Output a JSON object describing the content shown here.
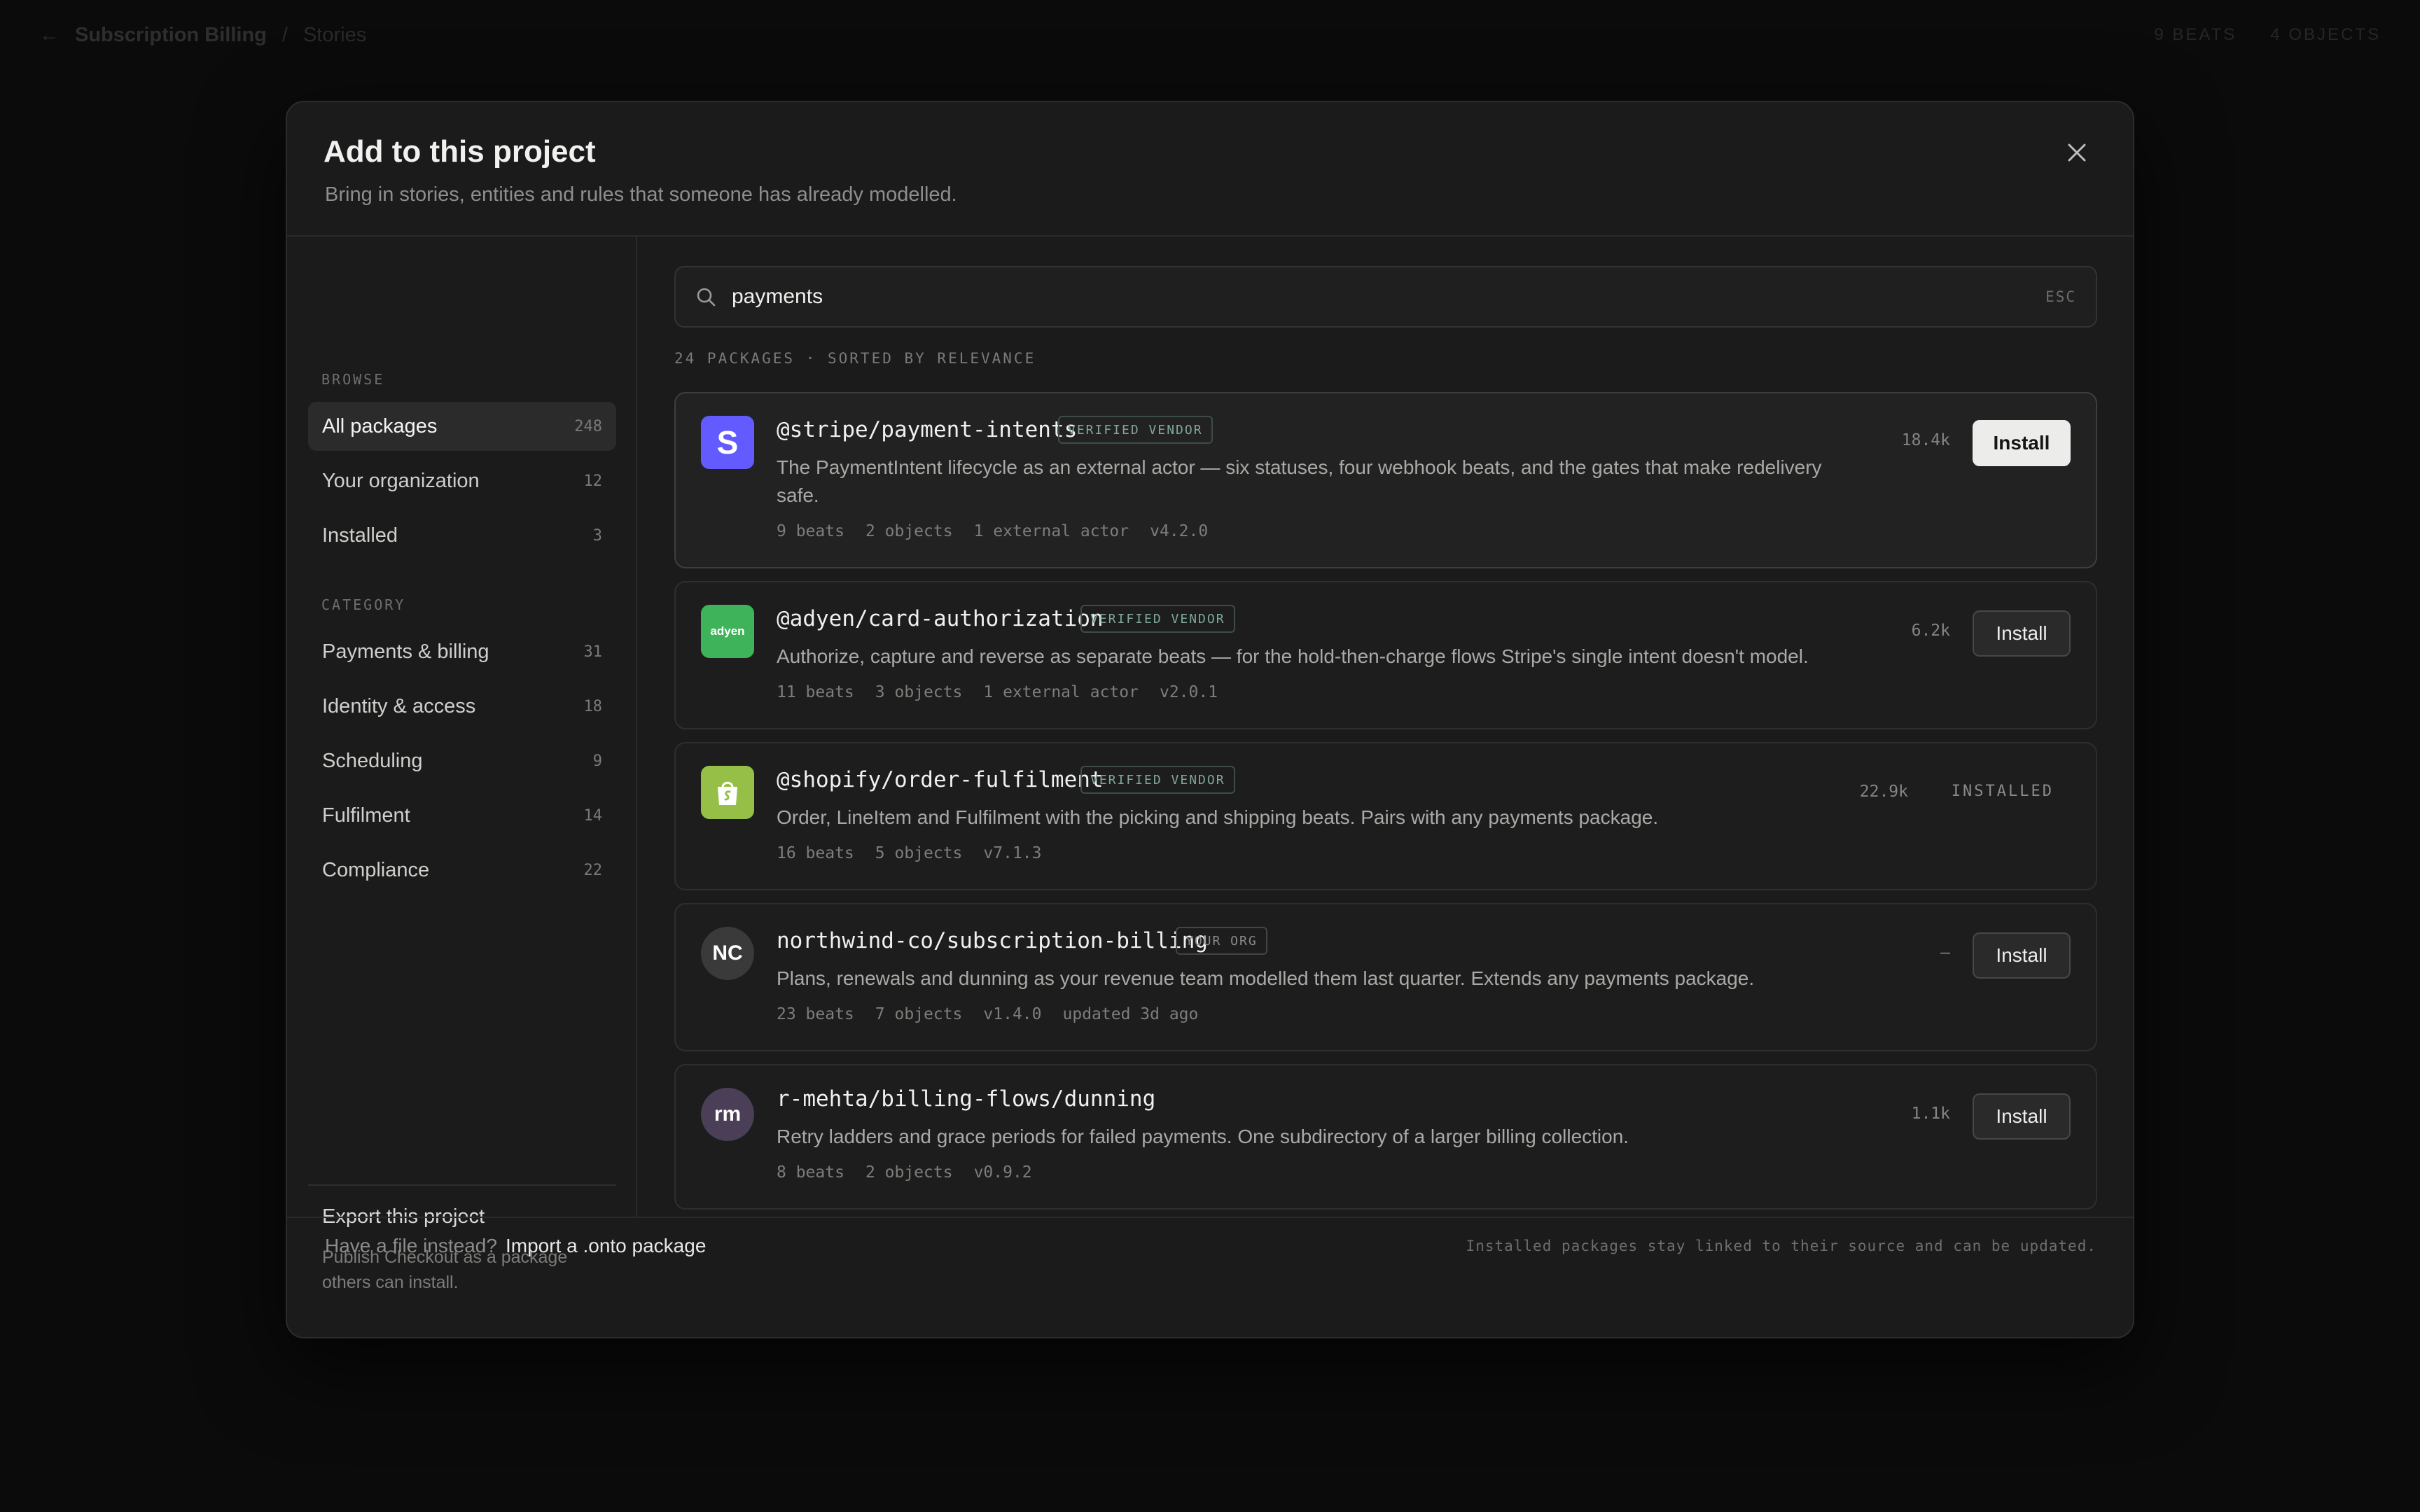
{
  "topbar": {
    "project": "Subscription Billing",
    "separator": "/",
    "section": "Stories",
    "right_a": "9 BEATS",
    "right_b": "4 OBJECTS"
  },
  "modal": {
    "title": "Add to this project",
    "subtitle": "Bring in stories, entities and rules that someone has already modelled."
  },
  "sidebar": {
    "browse_heading": "BROWSE",
    "browse": [
      {
        "label": "All packages",
        "count": "248"
      },
      {
        "label": "Your organization",
        "count": "12"
      },
      {
        "label": "Installed",
        "count": "3"
      }
    ],
    "category_heading": "CATEGORY",
    "categories": [
      {
        "label": "Payments & billing",
        "count": "31"
      },
      {
        "label": "Identity & access",
        "count": "18"
      },
      {
        "label": "Scheduling",
        "count": "9"
      },
      {
        "label": "Fulfilment",
        "count": "14"
      },
      {
        "label": "Compliance",
        "count": "22"
      }
    ],
    "export_title": "Export this project",
    "export_desc": "Publish Checkout as a package others can install."
  },
  "search": {
    "value": "payments",
    "esc": "ESC"
  },
  "results_meta": "24 PACKAGES · SORTED BY RELEVANCE",
  "packages": [
    {
      "name": "@stripe/payment-intents",
      "badge": "VERIFIED VENDOR",
      "description": "The PaymentIntent lifecycle as an external actor — six statuses, four webhook beats, and the gates that make redelivery safe.",
      "stats": [
        "9 beats",
        "2 objects",
        "1 external actor",
        "v4.2.0"
      ],
      "downloads": "18.4k",
      "action": "Install",
      "logo_text": "S",
      "logo_color": "#635bff"
    },
    {
      "name": "@adyen/card-authorization",
      "badge": "VERIFIED VENDOR",
      "description": "Authorize, capture and reverse as separate beats — for the hold-then-charge flows Stripe's single intent doesn't model.",
      "stats": [
        "11 beats",
        "3 objects",
        "1 external actor",
        "v2.0.1"
      ],
      "downloads": "6.2k",
      "action": "Install",
      "logo_text": "adyen",
      "logo_color": "#3fb35a"
    },
    {
      "name": "@shopify/order-fulfilment",
      "badge": "VERIFIED VENDOR",
      "description": "Order, LineItem and Fulfilment with the picking and shipping beats. Pairs with any payments package.",
      "stats": [
        "16 beats",
        "5 objects",
        "v7.1.3"
      ],
      "downloads": "22.9k",
      "action": "INSTALLED",
      "logo_color": "#95bf47"
    },
    {
      "name": "northwind-co/subscription-billing",
      "badge": "YOUR ORG",
      "description": "Plans, renewals and dunning as your revenue team modelled them last quarter. Extends any payments package.",
      "stats": [
        "23 beats",
        "7 objects",
        "v1.4.0",
        "updated 3d ago"
      ],
      "downloads": "–",
      "action": "Install",
      "logo_text": "NC",
      "logo_color": "#3a3a3a"
    },
    {
      "name": "r-mehta/billing-flows/dunning",
      "description": "Retry ladders and grace periods for failed payments. One subdirectory of a larger billing collection.",
      "stats": [
        "8 beats",
        "2 objects",
        "v0.9.2"
      ],
      "downloads": "1.1k",
      "action": "Install",
      "logo_text": "rm",
      "logo_color": "#4a3f56"
    }
  ],
  "footer": {
    "question": "Have a file instead?",
    "link": "Import a .onto package",
    "note": "Installed packages stay linked to their source and can be updated."
  }
}
